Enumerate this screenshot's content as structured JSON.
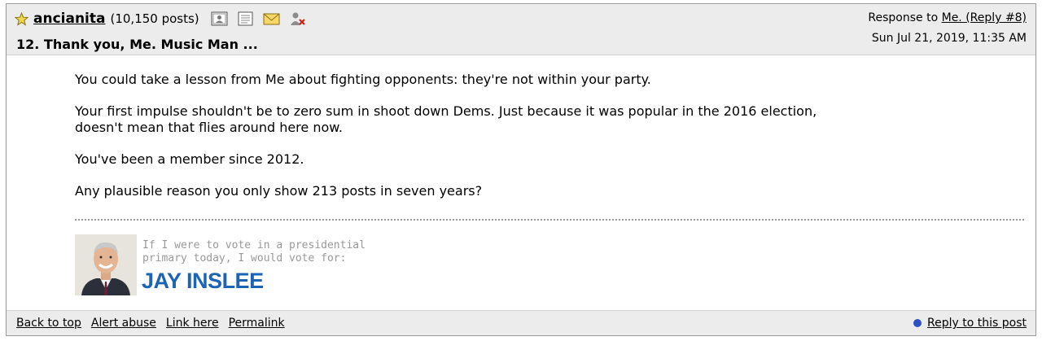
{
  "post": {
    "author": "ancianita",
    "post_count": "(10,150 posts)",
    "number_title": "12. Thank you, Me. Music Man ...",
    "response_prefix": "Response to",
    "response_link": "Me. (Reply #8)",
    "date": "Sun Jul 21, 2019, 11:35 AM",
    "body": [
      "You could take a lesson from Me about fighting opponents: they're not within your party.",
      "Your first impulse shouldn't be to zero sum in shoot down Dems. Just because it was popular in the 2016 election, doesn't mean that flies around here now.",
      "You've been a member since 2012.",
      "Any plausible reason you only show 213 posts in seven years?"
    ]
  },
  "header_icons": [
    "profile-icon",
    "journal-icon",
    "mail-icon",
    "ignore-icon"
  ],
  "signature": {
    "line1": "If I were to vote in a presidential",
    "line2": "primary today, I would vote for:",
    "candidate": "JAY INSLEE"
  },
  "footer": {
    "back_to_top": "Back to top",
    "alert_abuse": "Alert abuse",
    "link_here": "Link here",
    "permalink": "Permalink",
    "reply": "Reply to this post"
  },
  "colors": {
    "header_bg": "#ececec",
    "candidate_blue": "#1e64b4",
    "reply_dot": "#2c52c4"
  }
}
